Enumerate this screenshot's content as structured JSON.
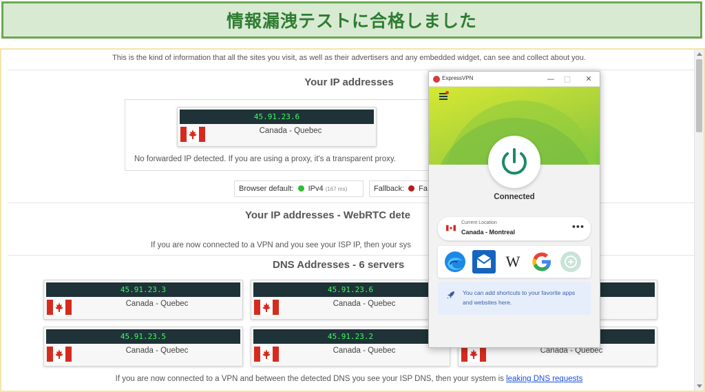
{
  "banner": {
    "title": "情報漏洩テストに合格しました"
  },
  "page": {
    "intro": "This is the kind of information that all the sites you visit, as well as their advertisers and any embedded widget, can see and collect about you.",
    "ip_section": {
      "heading": "Your IP addresses",
      "ip": "45.91.23.6",
      "location": "Canada - Quebec",
      "forward_note": "No forwarded IP detected. If you are using a proxy, it's a transparent proxy.",
      "browser_default_label": "Browser default:",
      "browser_default_value": "IPv4",
      "browser_default_ms": "(167 ms)",
      "fallback_label": "Fallback:",
      "fallback_value": "Fa"
    },
    "webrtc_section": {
      "heading": "Your IP addresses - WebRTC dete",
      "note": "If you are now connected to a VPN and you see your ISP IP, then your sys"
    },
    "dns_section": {
      "heading": "DNS Addresses - 6 servers",
      "servers": [
        {
          "ip": "45.91.23.3",
          "location": "Canada - Quebec"
        },
        {
          "ip": "45.91.23.6",
          "location": "Canada - Quebec"
        },
        {
          "ip": "",
          "location": ""
        },
        {
          "ip": "45.91.23.5",
          "location": "Canada - Quebec"
        },
        {
          "ip": "45.91.23.2",
          "location": "Canada - Quebec"
        },
        {
          "ip": "",
          "location": "Canada - Quebec"
        }
      ],
      "footer_prefix": "If you are now connected to a VPN and between the detected DNS you see your ISP DNS, then your system is ",
      "footer_link": "leaking DNS requests"
    }
  },
  "vpn": {
    "app_title": "ExpressVPN",
    "minimize": "—",
    "maximize": "□",
    "close": "✕",
    "status": "Connected",
    "current_location_label": "Current Location",
    "current_location_value": "Canada - Montreal",
    "more": "•••",
    "shortcuts": [
      "edge-icon",
      "mail-icon",
      "wikipedia-icon",
      "google-icon",
      "add-shortcut-icon"
    ],
    "wikipedia_glyph": "W",
    "hint": "You can add shortcuts to your favorite apps and websites here."
  },
  "colors": {
    "banner_bg": "#d9ead3",
    "banner_border": "#6aa84f",
    "banner_text": "#2e7d32",
    "ip_bar_bg": "#1e3238",
    "ip_text": "#3cff59",
    "vpn_green": "#a8d23b",
    "power_green": "#1c8a63",
    "link": "#1a4fd8"
  }
}
